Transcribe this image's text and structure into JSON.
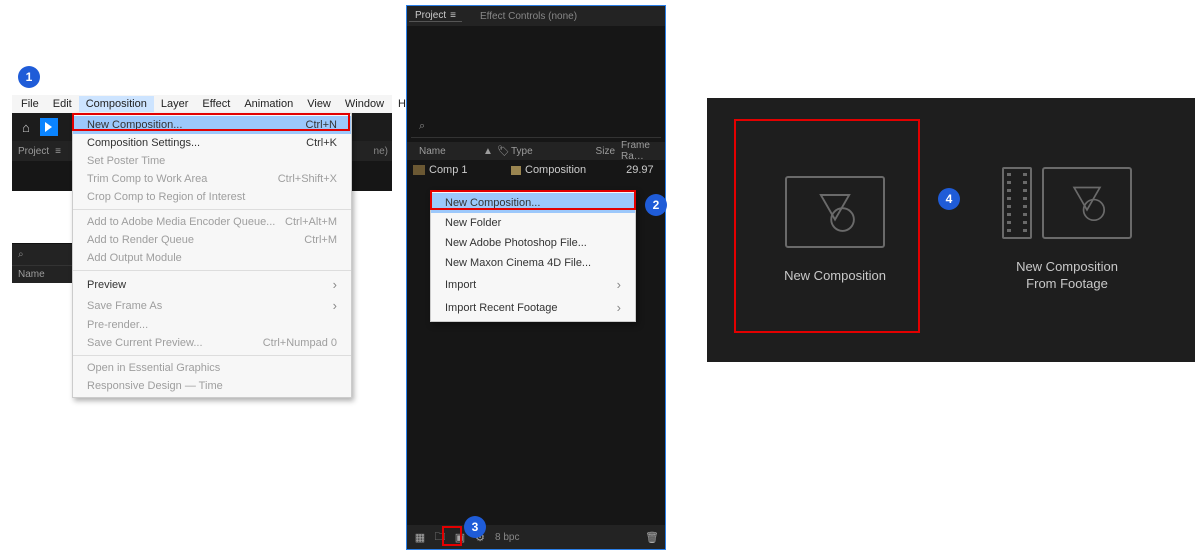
{
  "badges": {
    "b1": "1",
    "b2": "2",
    "b3": "3",
    "b4": "4"
  },
  "panel1": {
    "menubar": [
      "File",
      "Edit",
      "Composition",
      "Layer",
      "Effect",
      "Animation",
      "View",
      "Window",
      "Help"
    ],
    "selected_menu": "Composition",
    "project_tab": "Project",
    "hamburger": "≡",
    "ne_suffix": "ne)",
    "search_icon": "⌕",
    "name_col": "Name",
    "dropdown": {
      "groups": [
        [
          {
            "label": "New Composition...",
            "shortcut": "Ctrl+N",
            "highlight": true
          },
          {
            "label": "Composition Settings...",
            "shortcut": "Ctrl+K"
          },
          {
            "label": "Set Poster Time",
            "disabled": true
          },
          {
            "label": "Trim Comp to Work Area",
            "shortcut": "Ctrl+Shift+X",
            "disabled": true
          },
          {
            "label": "Crop Comp to Region of Interest",
            "disabled": true
          }
        ],
        [
          {
            "label": "Add to Adobe Media Encoder Queue...",
            "shortcut": "Ctrl+Alt+M",
            "disabled": true
          },
          {
            "label": "Add to Render Queue",
            "shortcut": "Ctrl+M",
            "disabled": true
          },
          {
            "label": "Add Output Module",
            "disabled": true
          }
        ],
        [
          {
            "label": "Preview",
            "submenu": true
          },
          {
            "label": "Save Frame As",
            "submenu": true,
            "disabled": true
          },
          {
            "label": "Pre-render...",
            "disabled": true
          },
          {
            "label": "Save Current Preview...",
            "shortcut": "Ctrl+Numpad 0",
            "disabled": true
          }
        ],
        [
          {
            "label": "Open in Essential Graphics",
            "disabled": true
          },
          {
            "label": "Responsive Design — Time",
            "disabled": true
          }
        ]
      ]
    }
  },
  "panel2": {
    "tabs": {
      "project": "Project",
      "effect_controls": "Effect Controls (none)"
    },
    "search_icon": "⌕",
    "columns": {
      "name": "Name",
      "type": "Type",
      "size": "Size",
      "frame_rate": "Frame Ra…"
    },
    "sort_icon": "▲",
    "tag_icon": "🏷",
    "row": {
      "name": "Comp 1",
      "type": "Composition",
      "size": "",
      "frame_rate": "29.97"
    },
    "context_menu": [
      {
        "label": "New Composition...",
        "highlight": true
      },
      {
        "label": "New Folder"
      },
      {
        "label": "New Adobe Photoshop File..."
      },
      {
        "label": "New Maxon Cinema 4D File..."
      },
      {
        "label": "Import",
        "submenu": true
      },
      {
        "label": "Import Recent Footage",
        "submenu": true
      }
    ],
    "footer": {
      "bpc": "8 bpc"
    }
  },
  "panel3": {
    "new_comp": "New Composition",
    "from_footage_l1": "New Composition",
    "from_footage_l2": "From Footage"
  }
}
